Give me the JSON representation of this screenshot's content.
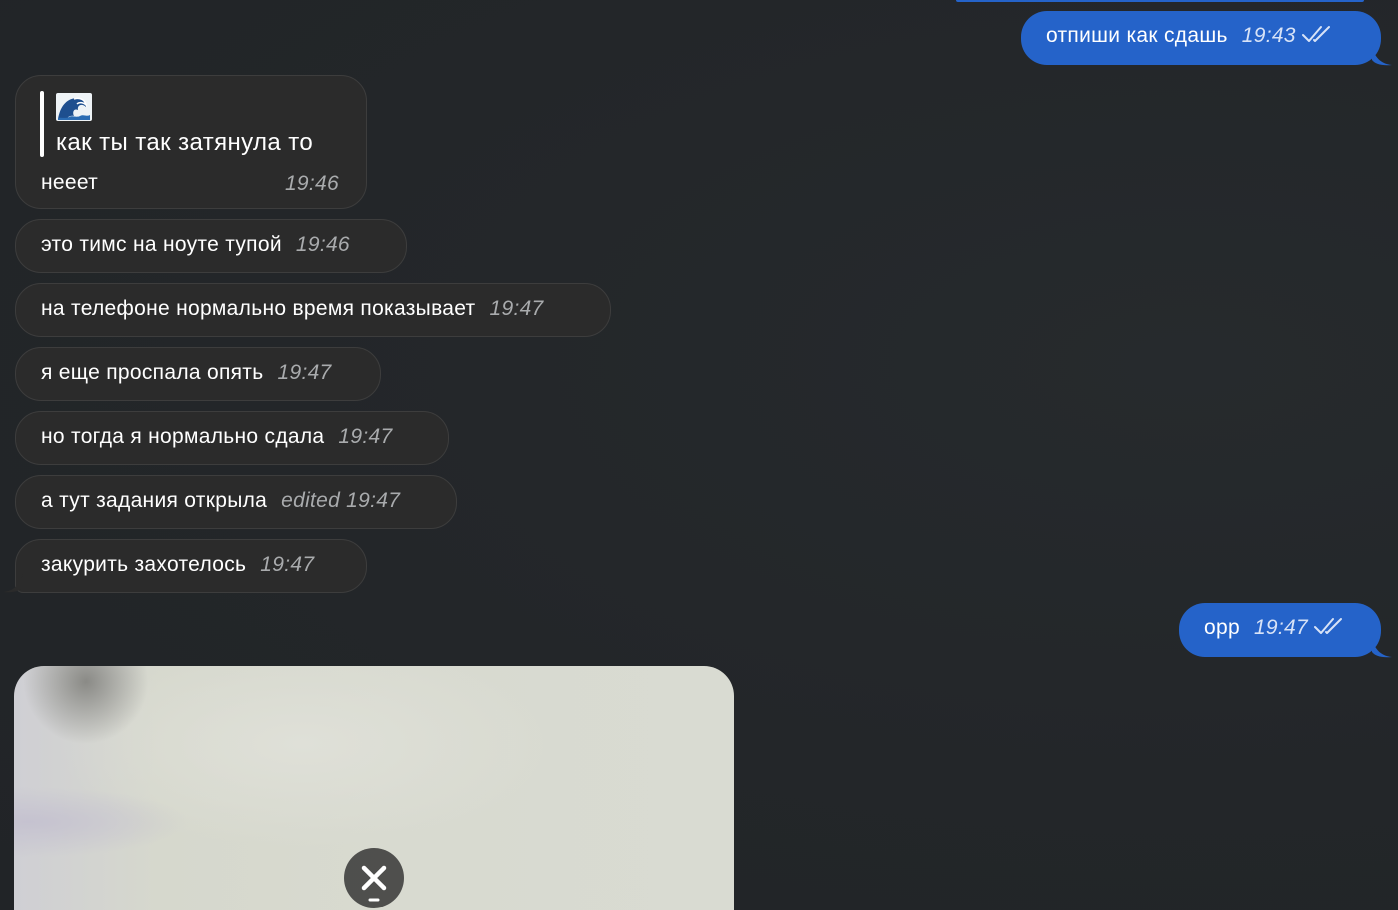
{
  "colors": {
    "background": "#232629",
    "incoming_bubble": "#2b2b2b",
    "outgoing_bubble": "#2563c9",
    "time_incoming": "#a9abad",
    "time_outgoing": "#d8e3f7"
  },
  "messages": [
    {
      "direction": "out",
      "text": "отпиши как сдашь",
      "time": "19:43",
      "status": "read-double-check-icon"
    },
    {
      "direction": "in",
      "reply_quote": {
        "emoji": "wave-emoji-icon",
        "text": "как ты так затянула то"
      },
      "text": "нееет",
      "time": "19:46"
    },
    {
      "direction": "in",
      "text": "это тимс на ноуте тупой",
      "time": "19:46"
    },
    {
      "direction": "in",
      "text": "на телефоне нормально время показывает",
      "time": "19:47"
    },
    {
      "direction": "in",
      "text": "я еще проспала опять",
      "time": "19:47"
    },
    {
      "direction": "in",
      "text": "но тогда я нормально сдала",
      "time": "19:47"
    },
    {
      "direction": "in",
      "text": "а тут задания открыла",
      "edited_label": "edited",
      "time": "19:47"
    },
    {
      "direction": "in",
      "text": "закурить захотелось",
      "time": "19:47"
    },
    {
      "direction": "out",
      "text": "орр",
      "time": "19:47",
      "status": "read-double-check-icon"
    }
  ],
  "media": {
    "type": "photo",
    "state": "loading",
    "cancel_icon": "close-icon"
  }
}
